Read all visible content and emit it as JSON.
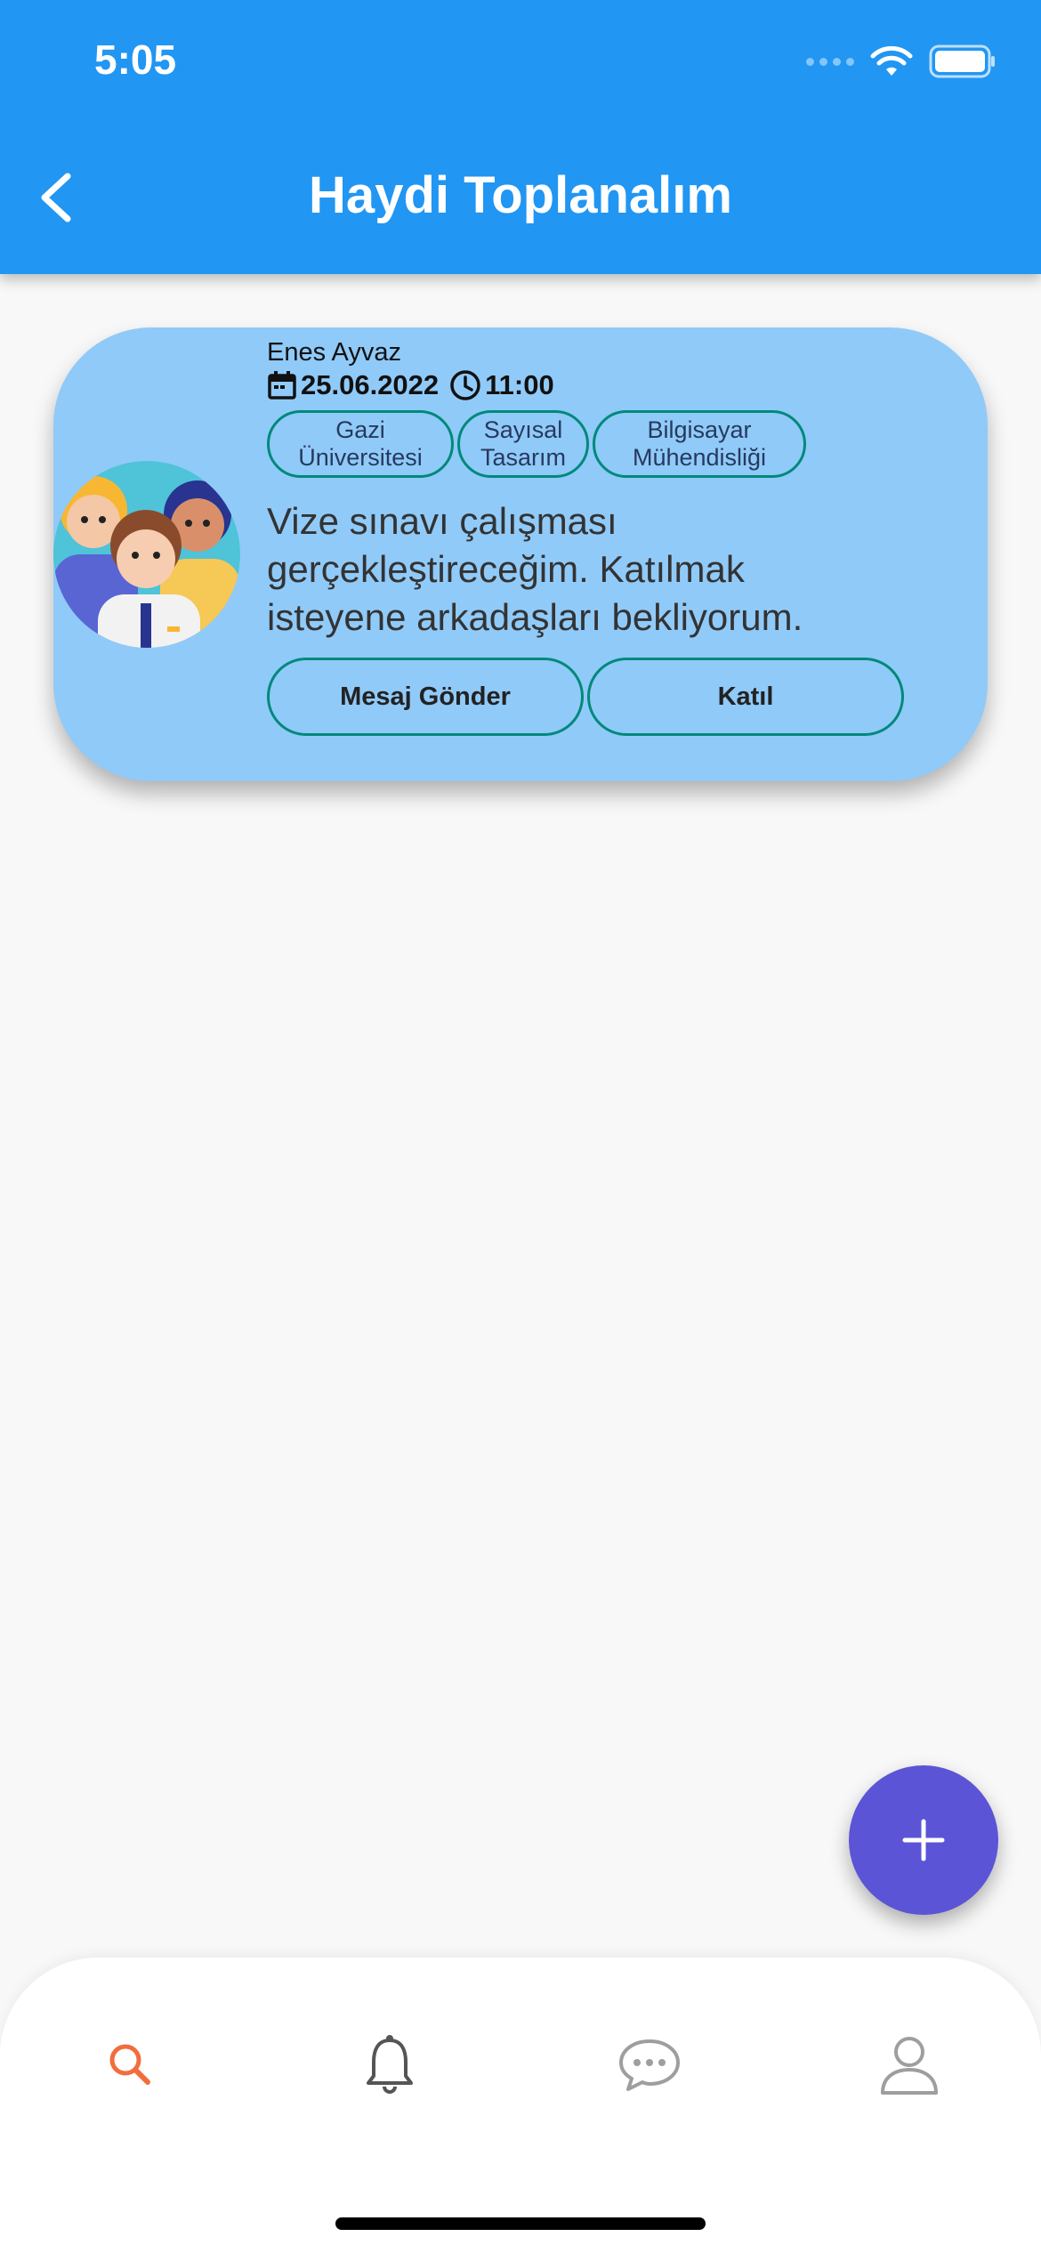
{
  "status_bar": {
    "time": "5:05"
  },
  "header": {
    "title": "Haydi Toplanalım"
  },
  "card": {
    "author": "Enes Ayvaz",
    "date": "25.06.2022",
    "time": "11:00",
    "tags": [
      {
        "label": "Gazi\nÜniversitesi"
      },
      {
        "label": "Sayısal\nTasarım"
      },
      {
        "label": "Bilgisayar\nMühendisliği"
      }
    ],
    "description": "Vize sınavı çalışması gerçekleştireceğim. Katılmak isteyene arkadaşları bekliyorum.",
    "message_button": "Mesaj Gönder",
    "join_button": "Katıl"
  },
  "bottom_nav": {
    "items": [
      {
        "icon": "search-icon",
        "active": true
      },
      {
        "icon": "bell-icon",
        "active": false
      },
      {
        "icon": "chat-icon",
        "active": false
      },
      {
        "icon": "profile-icon",
        "active": false
      }
    ]
  },
  "colors": {
    "appbar": "#2196f3",
    "card": "#90caf9",
    "chip_border": "#00897b",
    "fab": "#5b54d6",
    "nav_active": "#f26d3d",
    "nav_inactive": "#9e9e9e"
  }
}
